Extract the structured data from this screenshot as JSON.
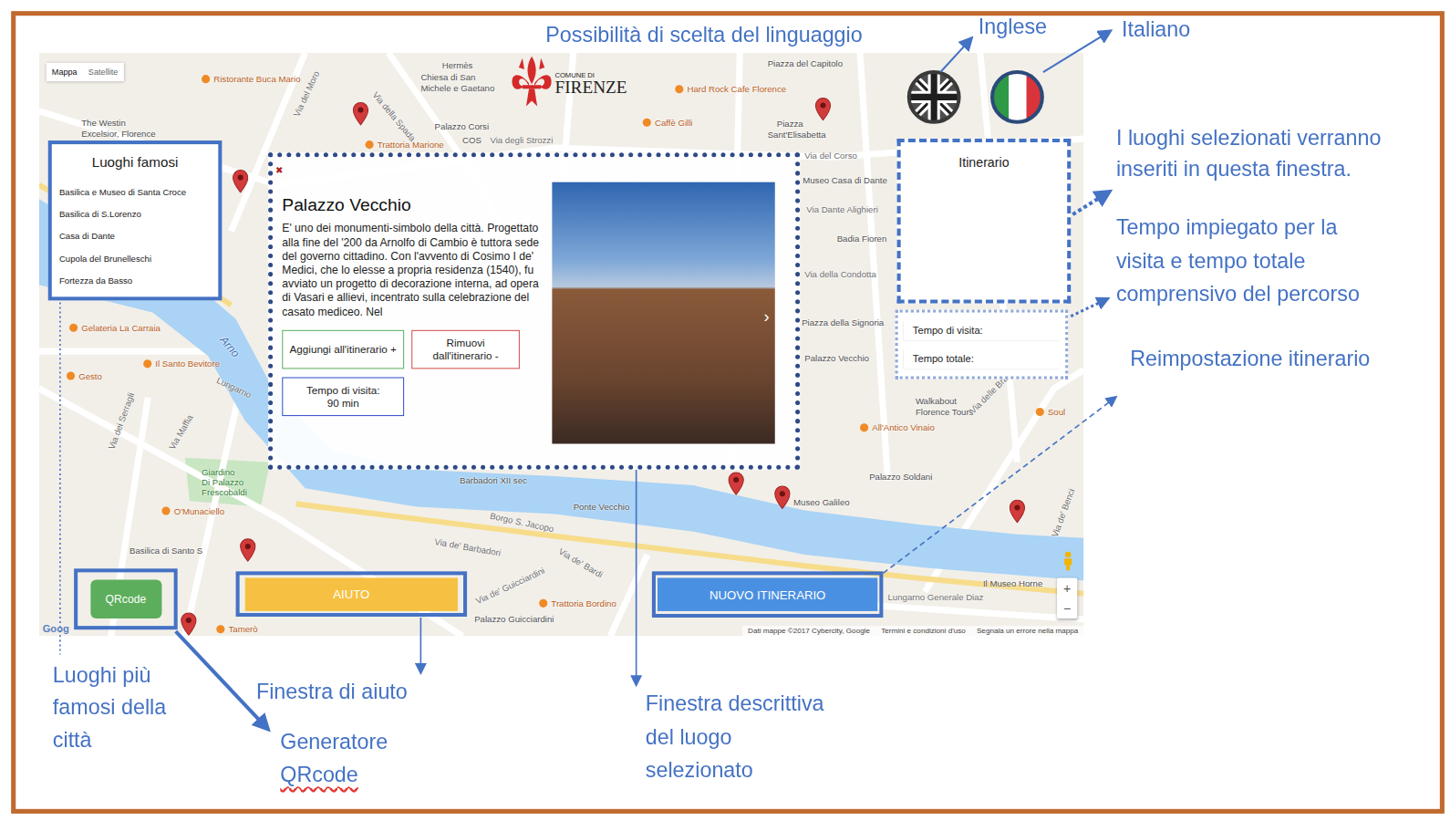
{
  "annotations": {
    "language": "Possibilità di scelta del linguaggio",
    "english": "Inglese",
    "italian": "Italiano",
    "itinerary": [
      "I luoghi selezionati verranno",
      "inseriti in questa finestra."
    ],
    "times": [
      "Tempo impiegato per la",
      "visita e tempo totale",
      "comprensivo del percorso"
    ],
    "reset": "Reimpostazione itinerario",
    "famous": [
      "Luoghi più",
      "famosi della",
      "città"
    ],
    "help": "Finestra di aiuto",
    "qr": [
      {
        "text": "Generatore",
        "misspelled": false
      },
      {
        "text": "QRcode",
        "misspelled": true
      }
    ],
    "description": [
      "Finestra descrittiva",
      "del luogo",
      "selezionato"
    ]
  },
  "map": {
    "type_buttons": [
      {
        "label": "Mappa",
        "selected": true
      },
      {
        "label": "Satellite",
        "selected": false
      }
    ],
    "labels": [
      {
        "text": "Ristorante Buca Mario",
        "kind": "food"
      },
      {
        "text": "Hermès",
        "kind": "place"
      },
      {
        "text": "Chiesa di San",
        "kind": "place"
      },
      {
        "text": "Michele e Gaetano",
        "kind": "place"
      },
      {
        "text": "Hard Rock Cafe Florence",
        "kind": "food"
      },
      {
        "text": "Piazza del Capitolo",
        "kind": "place"
      },
      {
        "text": "Caffè Gilli",
        "kind": "food"
      },
      {
        "text": "Piazza",
        "kind": "place"
      },
      {
        "text": "Sant'Elisabetta",
        "kind": "place"
      },
      {
        "text": "The Westin",
        "kind": "place"
      },
      {
        "text": "Excelsior, Florence",
        "kind": "place"
      },
      {
        "text": "Palazzo Corsi",
        "kind": "place"
      },
      {
        "text": "Trattoria Marione",
        "kind": "food"
      },
      {
        "text": "COS",
        "kind": "place"
      },
      {
        "text": "Via degli Strozzi",
        "kind": "street"
      },
      {
        "text": "Via del Corso",
        "kind": "street"
      },
      {
        "text": "Museo Casa di Dante",
        "kind": "place"
      },
      {
        "text": "Via Dante Alighieri",
        "kind": "street"
      },
      {
        "text": "Badia Fioren",
        "kind": "place"
      },
      {
        "text": "Via della Condotta",
        "kind": "street"
      },
      {
        "text": "Piazza della Signoria",
        "kind": "place"
      },
      {
        "text": "Palazzo Vecchio",
        "kind": "place"
      },
      {
        "text": "Walkabout",
        "kind": "place"
      },
      {
        "text": "Florence Tours",
        "kind": "place"
      },
      {
        "text": "All'Antico Vinaio",
        "kind": "food"
      },
      {
        "text": "Palazzo Soldani",
        "kind": "place"
      },
      {
        "text": "Museo Galileo",
        "kind": "place"
      },
      {
        "text": "Lungarno Generale Diaz",
        "kind": "street"
      },
      {
        "text": "Il Museo Horne",
        "kind": "place"
      },
      {
        "text": "Via de' Benci",
        "kind": "street"
      },
      {
        "text": "Via delle Brache",
        "kind": "street"
      },
      {
        "text": "Soul",
        "kind": "food"
      },
      {
        "text": "Ponte Vecchio",
        "kind": "place"
      },
      {
        "text": "Borgo S. Jacopo",
        "kind": "street"
      },
      {
        "text": "Via de' Barbadori",
        "kind": "street"
      },
      {
        "text": "Barbadori XII sec",
        "kind": "place"
      },
      {
        "text": "Via de' Bardi",
        "kind": "street"
      },
      {
        "text": "Via de' Guicciardini",
        "kind": "street"
      },
      {
        "text": "Trattoria Bordino",
        "kind": "food"
      },
      {
        "text": "Palazzo Guicciardini",
        "kind": "place"
      },
      {
        "text": "Tamerò",
        "kind": "food"
      },
      {
        "text": "Basilica di Santo S",
        "kind": "place"
      },
      {
        "text": "O'Munaciello",
        "kind": "food"
      },
      {
        "text": "Giardino",
        "kind": "park"
      },
      {
        "text": "Di Palazzo",
        "kind": "park"
      },
      {
        "text": "Frescobaldi",
        "kind": "park"
      },
      {
        "text": "Il Santo Bevitore",
        "kind": "food"
      },
      {
        "text": "Gelateria La Carraia",
        "kind": "food"
      },
      {
        "text": "Arno",
        "kind": "river"
      },
      {
        "text": "Lungarno",
        "kind": "street"
      },
      {
        "text": "Via dei Serragli",
        "kind": "street"
      },
      {
        "text": "Via Maffia",
        "kind": "street"
      },
      {
        "text": "Gesto",
        "kind": "food"
      },
      {
        "text": "Via del Moro",
        "kind": "street"
      },
      {
        "text": "Via della Spada",
        "kind": "street"
      }
    ],
    "zoom": [
      "+",
      "−"
    ],
    "google": "Goog",
    "footer": [
      "Dati mappe ©2017 Cybercity, Google",
      "Termini e condizioni d'uso",
      "Segnala un errore nella mappa"
    ]
  },
  "logo": {
    "small": "COMUNE DI",
    "name": "FIRENZE"
  },
  "languages": [
    {
      "kind": "uk"
    },
    {
      "kind": "it"
    }
  ],
  "famous_places": {
    "title": "Luoghi famosi",
    "items": [
      "Basilica e Museo di Santa Croce",
      "Basilica di S.Lorenzo",
      "Casa di Dante",
      "Cupola del Brunelleschi",
      "Fortezza da Basso"
    ]
  },
  "place": {
    "close": "✖",
    "title": "Palazzo Vecchio",
    "description": "E' uno dei monumenti-simbolo della città. Progettato alla fine del '200 da Arnolfo di Cambio è tuttora sede del governo cittadino. Con l'avvento di Cosimo I de' Medici, che lo elesse a propria residenza (1540), fu avviato un progetto di decorazione interna, ad opera di Vasari e allievi, incentrato sulla celebrazione del casato mediceo. Nel",
    "add": "Aggiungi all'itinerario +",
    "remove": "Rimuovi dall'itinerario -",
    "visit_label": "Tempo di visita:",
    "visit_value": "90 min",
    "next": "›"
  },
  "itinerary": {
    "title": "Itinerario",
    "items": []
  },
  "times": {
    "visit": "Tempo di visita:",
    "total": "Tempo totale:"
  },
  "buttons": {
    "qr": "QRcode",
    "help": "AIUTO",
    "new": "NUOVO ITINERARIO"
  }
}
